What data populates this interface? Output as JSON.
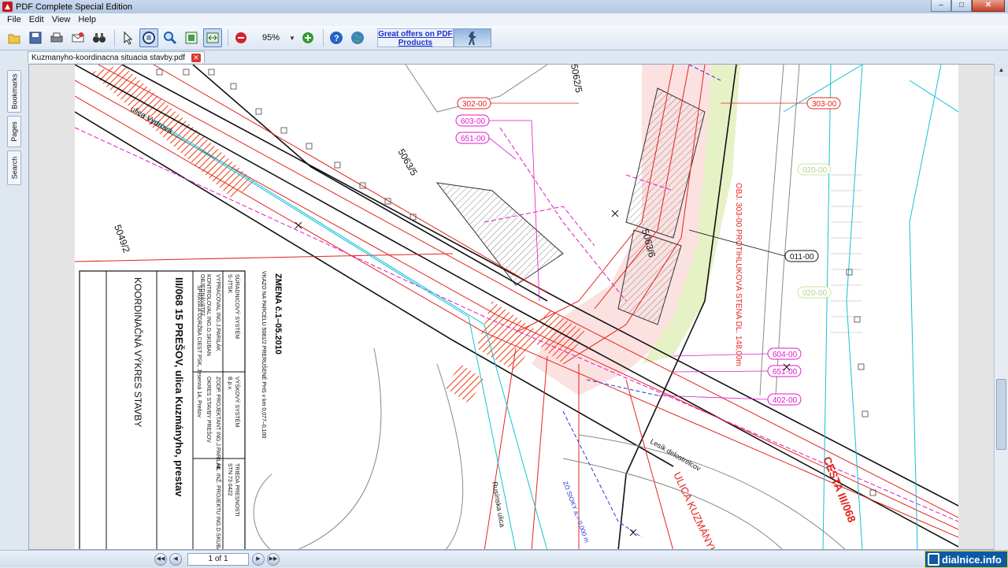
{
  "window": {
    "title": "PDF Complete Special Edition",
    "minimize": "–",
    "maximize": "□",
    "close": "✕"
  },
  "menu": {
    "file": "File",
    "edit": "Edit",
    "view": "View",
    "help": "Help"
  },
  "toolbar": {
    "zoom_value": "95%",
    "promo_text": "Great offers on PDF Products",
    "icons": [
      "open-icon",
      "save-icon",
      "print-icon",
      "email-icon",
      "find-binoculars-icon",
      "select-arrow-icon",
      "hand-tool-icon",
      "zoom-icon",
      "fit-page-icon",
      "fit-width-icon",
      "zoom-out-icon",
      "zoom-in-icon",
      "help-icon",
      "web-icon"
    ]
  },
  "document": {
    "tab_name": "Kuzmanyho-koordinacna situacia stavby.pdf"
  },
  "sidepanel": {
    "bookmarks": "Bookmarks",
    "pages": "Pages",
    "search": "Search"
  },
  "navigation": {
    "page_value": "1 of 1"
  },
  "watermark": {
    "text": "dialnice.info"
  },
  "drawing": {
    "labels": {
      "tag_302": "302-00",
      "tag_303": "303-00",
      "tag_603": "603-00",
      "tag_651a": "651-00",
      "tag_011": "011-00",
      "tag_604": "604-00",
      "tag_651b": "651-00",
      "tag_402": "402-00",
      "tag_020a": "020-00",
      "tag_020b": "020-00",
      "parcel_5049": "5049/2",
      "parcel_5063": "5063/5",
      "parcel_5063b": "5063/6",
      "parcel_5062": "5062/5",
      "ulica": "ulica Vydrová",
      "wall": "OBJ. 303-00  PROTIHLUKOVÁ  STENA  DL. 148,00m",
      "cesta": "CESTA III/068",
      "ul_kuzmanyho": "ULICA KUZMÁNYHO",
      "lesik": "Lesík delostrelcov",
      "rusinska": "Rusínska ulica",
      "zmena": "ZMENA č.1–05.2010",
      "zmena_note": "VKAZO NA PARCELU 5081/2 PRERUŠENÉ PHS v km 0,077–0,100",
      "title_main": "III/068  15  PREŠOV,  ulica  Kuzmányho,  prestav",
      "title_sub": "KOORDINAČNÁ  VÝKRES  STAVBY",
      "tb_row1": "SÚRADNICOVÝ SYSTÉM",
      "tb_row1b": "VÝŠKOVÝ SYSTÉM",
      "tb_row1c": "TRIEDA PRESNOSTI",
      "tb_row2": "S-JTSK",
      "tb_row2b": "B.p.v.",
      "tb_row2c": "STN 73 0422",
      "tb_row3": "VYPRACOVAL ING.J.PARILÁK",
      "tb_row4": "KONTROLOVAL ING.D.SKUBAN",
      "tb_row5": "OBJEDNÁVATEĽ",
      "tb_row5b": "SPRÁVA A ÚDRŽBA CIEST PSK, Jesenná 14, Prešov",
      "tb_row6": "OKRES STAVBY PREŠOV",
      "tb_row7": "ZODP. PROJEKTANT ING.J.PARILÁK",
      "tb_row8": "HL. INŽ. PROJEKTU ING.D.SKUBAN",
      "sight": "ZÓ SIOKY a,= 0,000 m"
    }
  }
}
